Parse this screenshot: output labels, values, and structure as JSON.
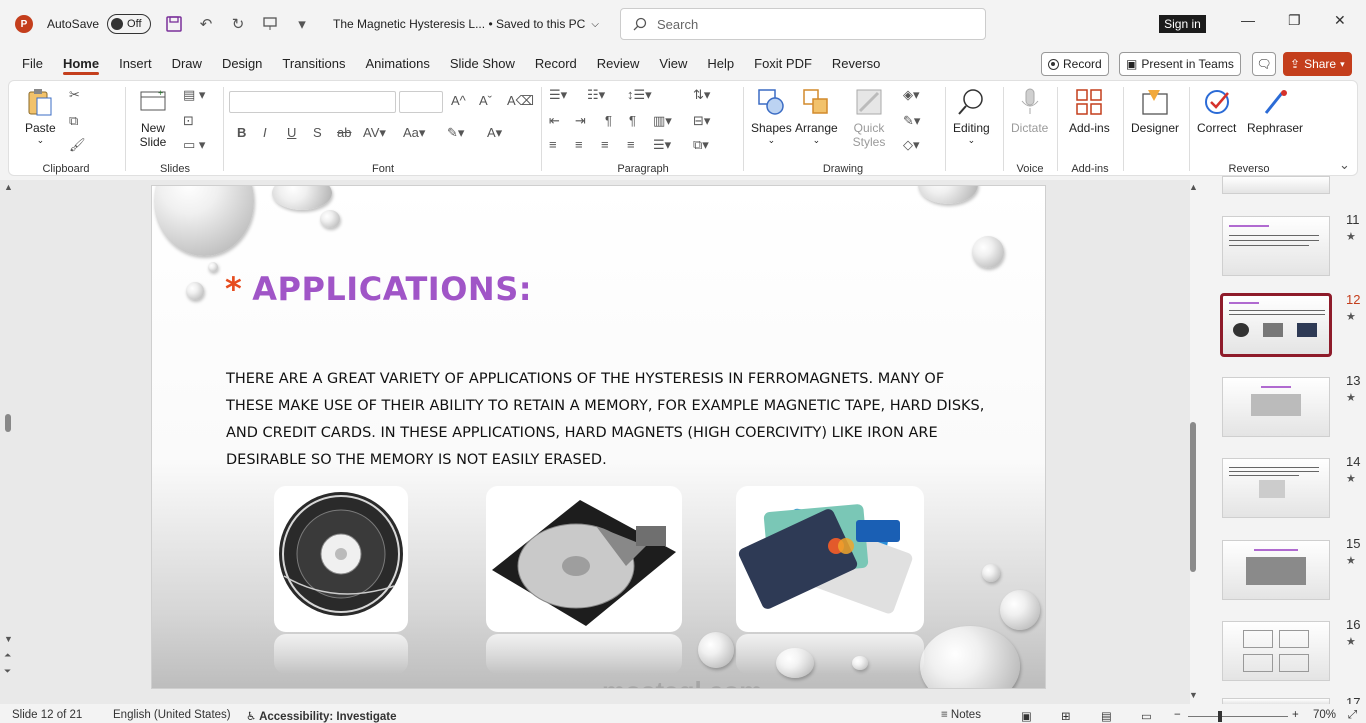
{
  "titlebar": {
    "autosave_label": "AutoSave",
    "autosave_state": "Off",
    "doc_title": "The Magnetic Hysteresis L...  •  Saved to this PC",
    "search_placeholder": "Search",
    "signin": "Sign in"
  },
  "menu": {
    "tabs": [
      "File",
      "Home",
      "Insert",
      "Draw",
      "Design",
      "Transitions",
      "Animations",
      "Slide Show",
      "Record",
      "Review",
      "View",
      "Help",
      "Foxit PDF",
      "Reverso"
    ],
    "active": "Home",
    "record_btn": "Record",
    "present_btn": "Present in Teams",
    "share_btn": "Share"
  },
  "ribbon": {
    "clipboard": {
      "label": "Clipboard",
      "paste": "Paste"
    },
    "slides": {
      "label": "Slides",
      "new_slide": "New Slide"
    },
    "font": {
      "label": "Font"
    },
    "paragraph": {
      "label": "Paragraph"
    },
    "drawing": {
      "label": "Drawing",
      "shapes": "Shapes",
      "arrange": "Arrange",
      "quick_styles": "Quick Styles"
    },
    "editing": {
      "label": "Editing"
    },
    "voice": {
      "label": "Voice",
      "dictate": "Dictate"
    },
    "addins": {
      "label": "Add-ins",
      "addins_btn": "Add-ins"
    },
    "designer": {
      "label": "Designer"
    },
    "reverso": {
      "label": "Reverso",
      "correct": "Correct",
      "rephraser": "Rephraser"
    }
  },
  "slide": {
    "title": "APPLICATIONS:",
    "bullet": "*",
    "body": "THERE ARE A GREAT VARIETY OF APPLICATIONS OF THE HYSTERESIS IN FERROMAGNETS. MANY OF THESE MAKE USE OF THEIR ABILITY TO RETAIN A MEMORY, FOR EXAMPLE MAGNETIC TAPE, HARD DISKS, AND CREDIT CARDS. IN THESE APPLICATIONS, HARD MAGNETS (HIGH COERCIVITY) LIKE IRON ARE DESIRABLE SO THE MEMORY IS NOT EASILY ERASED.",
    "watermark": "mostaql.com"
  },
  "thumbnails": [
    {
      "num": "11",
      "star": "★",
      "selected": false
    },
    {
      "num": "12",
      "star": "★",
      "selected": true
    },
    {
      "num": "13",
      "star": "★",
      "selected": false
    },
    {
      "num": "14",
      "star": "★",
      "selected": false
    },
    {
      "num": "15",
      "star": "★",
      "selected": false
    },
    {
      "num": "16",
      "star": "★",
      "selected": false
    },
    {
      "num": "17",
      "star": "",
      "selected": false
    }
  ],
  "status": {
    "slide_info": "Slide 12 of 21",
    "language": "English (United States)",
    "accessibility": "Accessibility: Investigate",
    "notes": "Notes",
    "zoom": "70%"
  },
  "colors": {
    "accent": "#c43e1c",
    "title": "#a055c7",
    "bullet": "#e64c1e",
    "selected_thumb": "#8e1b2a"
  }
}
